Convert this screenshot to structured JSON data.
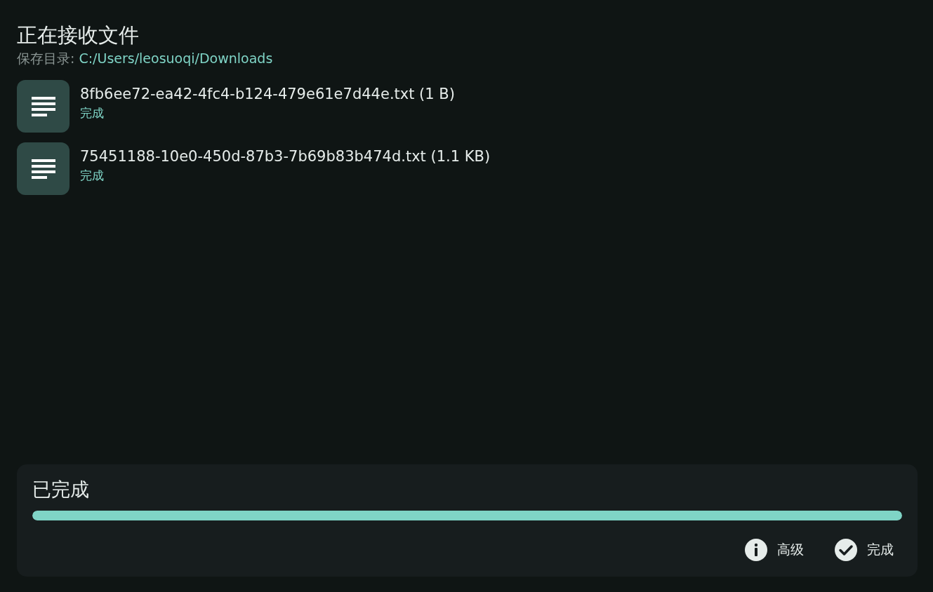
{
  "header": {
    "title": "正在接收文件",
    "save_label": "保存目录:",
    "save_path": "C:/Users/leosuoqi/Downloads"
  },
  "files": [
    {
      "name": "8fb6ee72-ea42-4fc4-b124-479e61e7d44e.txt (1 B)",
      "status": "完成"
    },
    {
      "name": "75451188-10e0-450d-87b3-7b69b83b474d.txt (1.1 KB)",
      "status": "完成"
    }
  ],
  "progress": {
    "title": "已完成",
    "level": 1
  },
  "buttons": [
    {
      "kind": "info",
      "label": "高级"
    },
    {
      "kind": "done",
      "label": "完成"
    }
  ]
}
